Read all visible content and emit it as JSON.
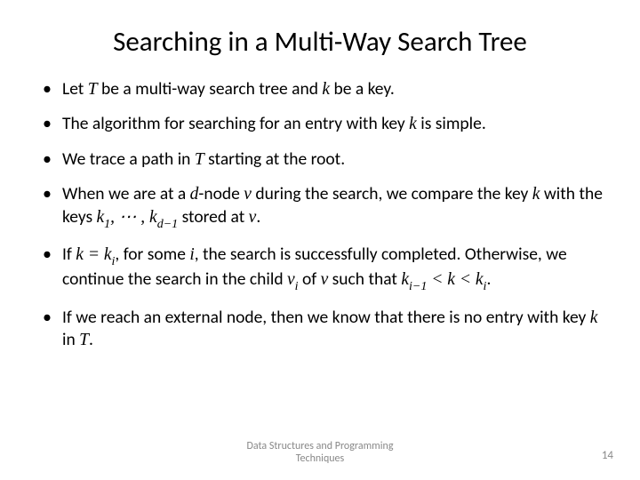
{
  "title": "Searching in a Multi-Way Search Tree",
  "bullets": {
    "b1_pre": "Let ",
    "b1_mid": " be a multi-way search tree and ",
    "b1_post": " be a key.",
    "b2_pre": "The algorithm for searching for an entry with key ",
    "b2_post": " is simple.",
    "b3_pre": "We trace a path in ",
    "b3_post": " starting at the root.",
    "b4_pre": "When we are at a ",
    "b4_mid1": "-node ",
    "b4_mid2": " during the search, we compare the key ",
    "b4_mid3": " with the keys ",
    "b4_mid4": " stored at ",
    "b4_post": ".",
    "b5_pre": "If ",
    "b5_mid1": ", for some ",
    "b5_mid2": ", the search is successfully completed. Otherwise, we continue the search in the child ",
    "b5_mid3": " of ",
    "b5_mid4": " such that ",
    "b5_post": ".",
    "b6_pre": "If we reach an external node, then we know that there is no entry with key ",
    "b6_mid": " in ",
    "b6_post": "."
  },
  "math": {
    "T": "T",
    "k": "k",
    "d": "d",
    "v": "v",
    "i": "i",
    "k1": "k",
    "k1_sub": "1",
    "kd1": "k",
    "kd1_sub": "d−1",
    "ki": "k",
    "ki_sub": "i",
    "vi": "v",
    "vi_sub": "i",
    "ki1": "k",
    "ki1_sub": "i−1",
    "dots": ", ⋯ , ",
    "eq": " = ",
    "lt1": " < ",
    "lt2": " < "
  },
  "footer": {
    "line1": "Data Structures and Programming",
    "line2": "Techniques"
  },
  "page": "14"
}
